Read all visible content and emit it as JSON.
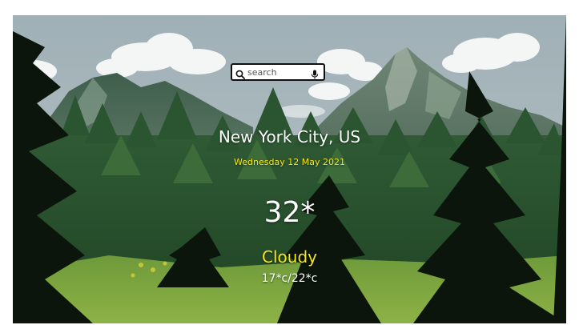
{
  "search": {
    "placeholder": "search",
    "search_icon": "magnifier-icon",
    "mic_icon": "microphone-icon"
  },
  "weather": {
    "city": "New York City, US",
    "date": "Wednesday 12 May 2021",
    "temperature": "32*",
    "condition": "Cloudy",
    "range": "17*c/22*c"
  },
  "colors": {
    "accent_yellow": "#f5e61a",
    "text_white": "#ffffff",
    "sky": "#a8b7bd"
  }
}
